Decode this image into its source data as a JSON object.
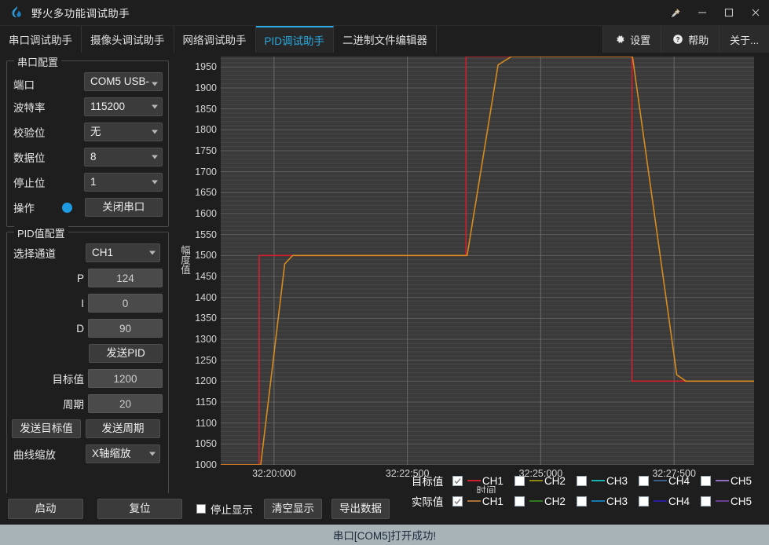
{
  "window": {
    "title": "野火多功能调试助手",
    "controls": {
      "pin": "pin-icon",
      "minimize": "—",
      "maximize": "□",
      "close": "✕"
    }
  },
  "tabs": [
    {
      "label": "串口调试助手",
      "active": false
    },
    {
      "label": "摄像头调试助手",
      "active": false
    },
    {
      "label": "网络调试助手",
      "active": false
    },
    {
      "label": "PID调试助手",
      "active": true
    },
    {
      "label": "二进制文件编辑器",
      "active": false
    }
  ],
  "header_buttons": [
    {
      "label": "设置",
      "icon": "gear-icon"
    },
    {
      "label": "帮助",
      "icon": "question-circle-icon"
    },
    {
      "label": "关于...",
      "icon": "none"
    }
  ],
  "serial_config": {
    "title": "串口配置",
    "port": {
      "label": "端口",
      "value": "COM5 USB-"
    },
    "baud": {
      "label": "波特率",
      "value": "115200"
    },
    "parity": {
      "label": "校验位",
      "value": "无"
    },
    "databits": {
      "label": "数据位",
      "value": "8"
    },
    "stopbits": {
      "label": "停止位",
      "value": "1"
    },
    "operation": {
      "label": "操作",
      "button": "关闭串口",
      "indicator_color": "#1e9ae0"
    }
  },
  "pid_config": {
    "title": "PID值配置",
    "channel": {
      "label": "选择通道",
      "value": "CH1"
    },
    "p": {
      "label": "P",
      "value": "124"
    },
    "i": {
      "label": "I",
      "value": "0"
    },
    "d": {
      "label": "D",
      "value": "90"
    },
    "send_pid": "发送PID",
    "target": {
      "label": "目标值",
      "value": "1200"
    },
    "period": {
      "label": "周期",
      "value": "20"
    },
    "send_target": "发送目标值",
    "send_period": "发送周期",
    "zoom": {
      "label": "曲线缩放",
      "value": "X轴缩放"
    }
  },
  "bottom_controls": {
    "start": "启动",
    "reset": "复位",
    "stop_display": "停止显示",
    "stop_display_checked": false,
    "clear_display": "清空显示",
    "export_data": "导出数据"
  },
  "legend": {
    "rows": [
      {
        "label": "目标值",
        "items": [
          {
            "name": "CH1",
            "checked": true,
            "color": "#d21f2e"
          },
          {
            "name": "CH2",
            "checked": false,
            "color": "#8a8a12"
          },
          {
            "name": "CH3",
            "checked": false,
            "color": "#17b3b3"
          },
          {
            "name": "CH4",
            "checked": false,
            "color": "#3a5f8a"
          },
          {
            "name": "CH5",
            "checked": false,
            "color": "#8f6fbf"
          }
        ]
      },
      {
        "label": "实际值",
        "items": [
          {
            "name": "CH1",
            "checked": true,
            "color": "#a9713a"
          },
          {
            "name": "CH2",
            "checked": false,
            "color": "#2f7a1e"
          },
          {
            "name": "CH3",
            "checked": false,
            "color": "#1878b4"
          },
          {
            "name": "CH4",
            "checked": false,
            "color": "#2b1fa0"
          },
          {
            "name": "CH5",
            "checked": false,
            "color": "#6a3f8f"
          }
        ]
      }
    ]
  },
  "status_bar": {
    "text": "串口[COM5]打开成功!"
  },
  "chart_data": {
    "type": "line",
    "title": "",
    "xlabel": "时间",
    "ylabel": "幅度值",
    "grid": true,
    "legend_position": "bottom-right",
    "ylim": [
      1000,
      1975
    ],
    "yticks": [
      1000,
      1050,
      1100,
      1150,
      1200,
      1250,
      1300,
      1350,
      1400,
      1450,
      1500,
      1550,
      1600,
      1650,
      1700,
      1750,
      1800,
      1850,
      1900,
      1950
    ],
    "xlim": [
      0,
      10.0
    ],
    "xticks": [
      1.0,
      3.5,
      6.0,
      8.5
    ],
    "xticklabels": [
      "32:20:000",
      "32:22:500",
      "32:25:000",
      "32:27:500"
    ],
    "series": [
      {
        "name": "目标值 CH1",
        "color": "#d21f2e",
        "x": [
          0.0,
          0.72,
          0.72,
          4.6,
          4.6,
          7.71,
          7.71,
          10.0
        ],
        "y": [
          1000,
          1000,
          1500,
          1500,
          1975,
          1975,
          1200,
          1200
        ]
      },
      {
        "name": "实际值 CH1",
        "color": "#d78b1e",
        "x": [
          0.0,
          0.75,
          1.2,
          1.35,
          4.62,
          5.2,
          5.45,
          7.72,
          8.55,
          8.72,
          10.0
        ],
        "y": [
          1000,
          1000,
          1480,
          1500,
          1500,
          1955,
          1975,
          1975,
          1215,
          1200,
          1200
        ]
      }
    ]
  }
}
